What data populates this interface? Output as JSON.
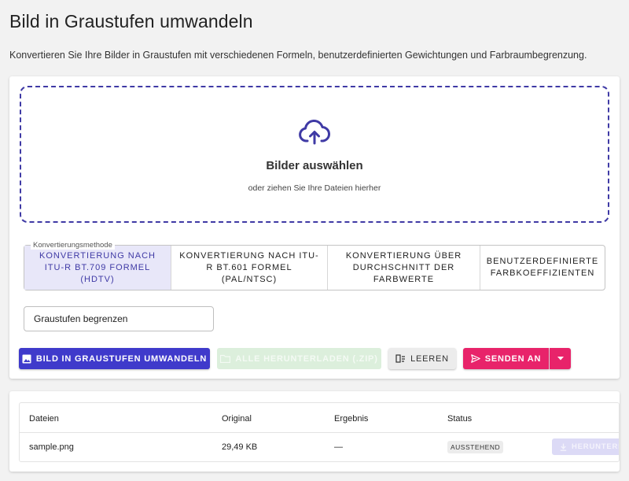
{
  "page": {
    "title": "Bild in Graustufen umwandeln",
    "description": "Konvertieren Sie Ihre Bilder in Graustufen mit verschiedenen Formeln, benutzerdefinierten Gewichtungen und Farbraumbegrenzung."
  },
  "dropzone": {
    "icon": "cloud-upload-icon",
    "title": "Bilder auswählen",
    "subtitle": "oder ziehen Sie Ihre Dateien hierher"
  },
  "method": {
    "legend": "Konvertierungsmethode",
    "options": [
      {
        "label": "KONVERTIERUNG NACH ITU-R BT.709 FORMEL (HDTV)",
        "selected": true
      },
      {
        "label": "KONVERTIERUNG NACH ITU-R BT.601 FORMEL (PAL/NTSC)",
        "selected": false
      },
      {
        "label": "KONVERTIERUNG ÜBER DURCHSCHNITT DER FARBWERTE",
        "selected": false
      },
      {
        "label": "BENUTZERDEFINIERTE FARBKOEFFIZIENTEN",
        "selected": false
      }
    ]
  },
  "limit_input": {
    "value": "Graustufen begrenzen"
  },
  "toolbar": {
    "convert_label": "BILD IN GRAUSTUFEN UMWANDELN",
    "download_all_label": "ALLE HERUNTERLADEN (.ZIP)",
    "clear_label": "LEEREN",
    "send_label": "SENDEN AN"
  },
  "table": {
    "headers": [
      "Dateien",
      "Original",
      "Ergebnis",
      "Status"
    ],
    "rows": [
      {
        "file": "sample.png",
        "original": "29,49 KB",
        "result": "—",
        "status": "AUSSTEHEND",
        "action": "HERUNTERLA"
      }
    ]
  },
  "colors": {
    "primary": "#3f3acb",
    "accent": "#e8236a",
    "selected_bg": "#e8e7f9",
    "disabled_green": "#dcefdc"
  }
}
